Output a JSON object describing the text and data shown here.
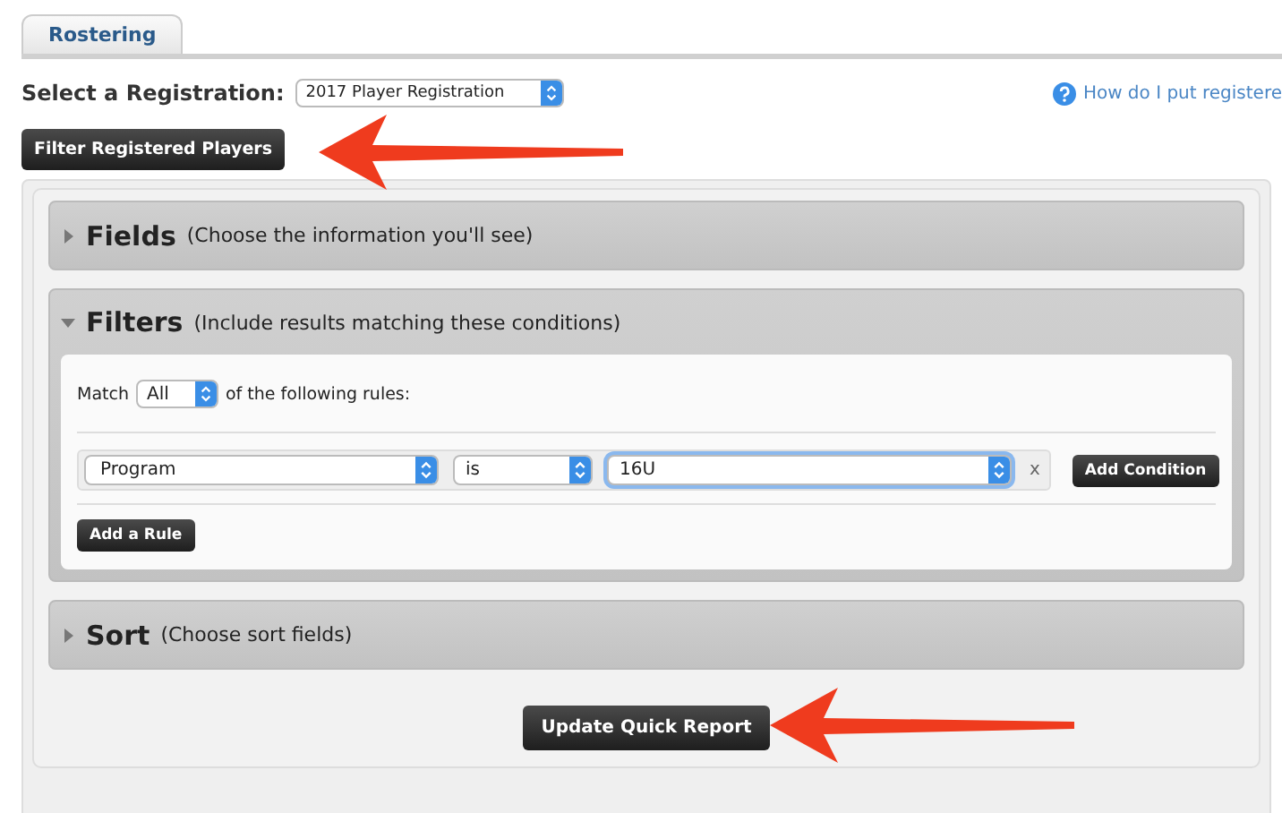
{
  "tabs": [
    {
      "label": "Rostering",
      "selected": true
    }
  ],
  "registration": {
    "label": "Select a Registration:",
    "value": "2017 Player Registration"
  },
  "help_link": "How do I put registere",
  "filter_button": "Filter Registered Players",
  "sections": [
    {
      "title": "Fields",
      "hint": "(Choose the information you'll see)",
      "expanded": false
    },
    {
      "title": "Filters",
      "hint": "(Include results matching these conditions)",
      "expanded": true
    },
    {
      "title": "Sort",
      "hint": "(Choose sort fields)",
      "expanded": false
    }
  ],
  "filters": {
    "match_label": "Match",
    "match_value": "All",
    "match_suffix": "of the following rules:",
    "rules": [
      {
        "field": "Program",
        "operator": "is",
        "value": "16U",
        "remove": "x",
        "add_button": "Add Condition"
      }
    ],
    "add_rule_button": "Add a Rule"
  },
  "update_button": "Update Quick Report"
}
